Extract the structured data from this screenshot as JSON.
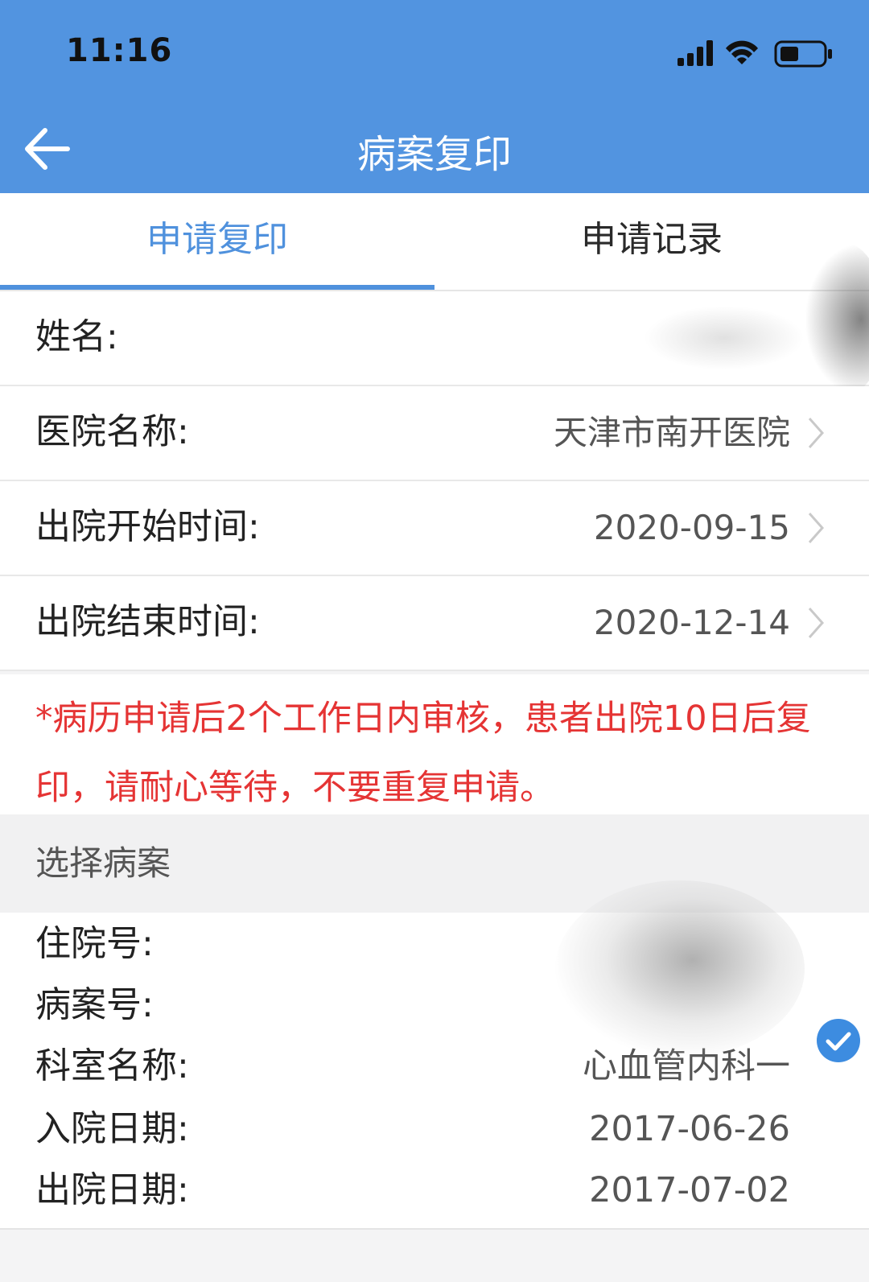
{
  "status_bar": {
    "time": "11:16"
  },
  "nav": {
    "title": "病案复印"
  },
  "tabs": [
    {
      "label": "申请复印",
      "active": true
    },
    {
      "label": "申请记录",
      "active": false
    }
  ],
  "form": {
    "name": {
      "label": "姓名:",
      "value": ""
    },
    "hospital": {
      "label": "医院名称:",
      "value": "天津市南开医院"
    },
    "discharge_start": {
      "label": "出院开始时间:",
      "value": "2020-09-15"
    },
    "discharge_end": {
      "label": "出院结束时间:",
      "value": "2020-12-14"
    }
  },
  "notice": "*病历申请后2个工作日内审核，患者出院10日后复印，请耐心等待，不要重复申请。",
  "section": {
    "title": "选择病案"
  },
  "record": {
    "admission_no": {
      "label": "住院号:",
      "value": ""
    },
    "case_no": {
      "label": "病案号:",
      "value": ""
    },
    "department": {
      "label": "科室名称:",
      "value": "心血管内科一"
    },
    "admit_date": {
      "label": "入院日期:",
      "value": "2017-06-26"
    },
    "discharge_date": {
      "label": "出院日期:",
      "value": "2017-07-02"
    },
    "selected": true
  },
  "colors": {
    "header": "#5294e0",
    "accent": "#4f91dd",
    "notice": "#e53434",
    "check": "#3d8ce0"
  },
  "icons": [
    "back-arrow-icon",
    "signal-icon",
    "wifi-icon",
    "battery-icon",
    "chevron-right-icon",
    "check-circle-icon"
  ]
}
